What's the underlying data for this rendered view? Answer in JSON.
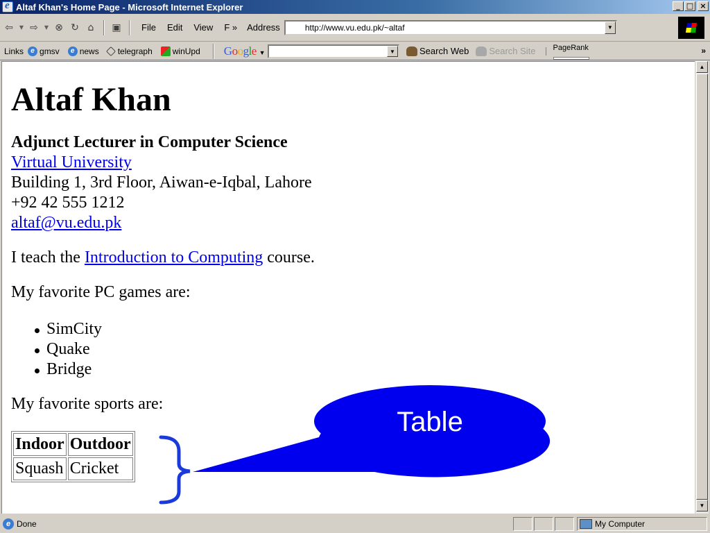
{
  "window": {
    "title": "Altaf Khan's Home Page - Microsoft Internet Explorer",
    "minimize": "_",
    "maximize": "□",
    "close": "×"
  },
  "toolbar": {
    "back_icon": "⇦",
    "forward_icon": "⇨",
    "stop_icon": "⊗",
    "refresh_icon": "↻",
    "home_icon": "⌂",
    "menus": [
      "File",
      "Edit",
      "View",
      "F »"
    ],
    "address_label": "Address",
    "address_value": "http://www.vu.edu.pk/~altaf"
  },
  "links_bar": {
    "label": "Links",
    "items": [
      "gmsv",
      "news",
      "telegraph",
      "winUpd"
    ],
    "google_search_btn": "Search Web",
    "search_site_btn": "Search Site",
    "pagerank_label": "PageRank",
    "more": "»"
  },
  "page": {
    "heading": "Altaf Khan",
    "position": "Adjunct Lecturer in Computer Science",
    "university_link": "Virtual University",
    "address": "Building 1, 3rd Floor, Aiwan-e-Iqbal, Lahore",
    "phone": "+92 42 555 1212",
    "email": "altaf@vu.edu.pk",
    "teach_prefix": "I teach the ",
    "course_link": "Introduction to Computing",
    "teach_suffix": " course.",
    "games_intro": "My favorite PC games are:",
    "games": [
      "SimCity",
      "Quake",
      "Bridge"
    ],
    "sports_intro": "My favorite sports are:",
    "sports_table": {
      "headers": [
        "Indoor",
        "Outdoor"
      ],
      "rows": [
        [
          "Squash",
          "Cricket"
        ]
      ]
    }
  },
  "status": {
    "text": "Done",
    "zone": "My Computer"
  },
  "annotation": {
    "label": "Table",
    "color": "#0000ee"
  }
}
